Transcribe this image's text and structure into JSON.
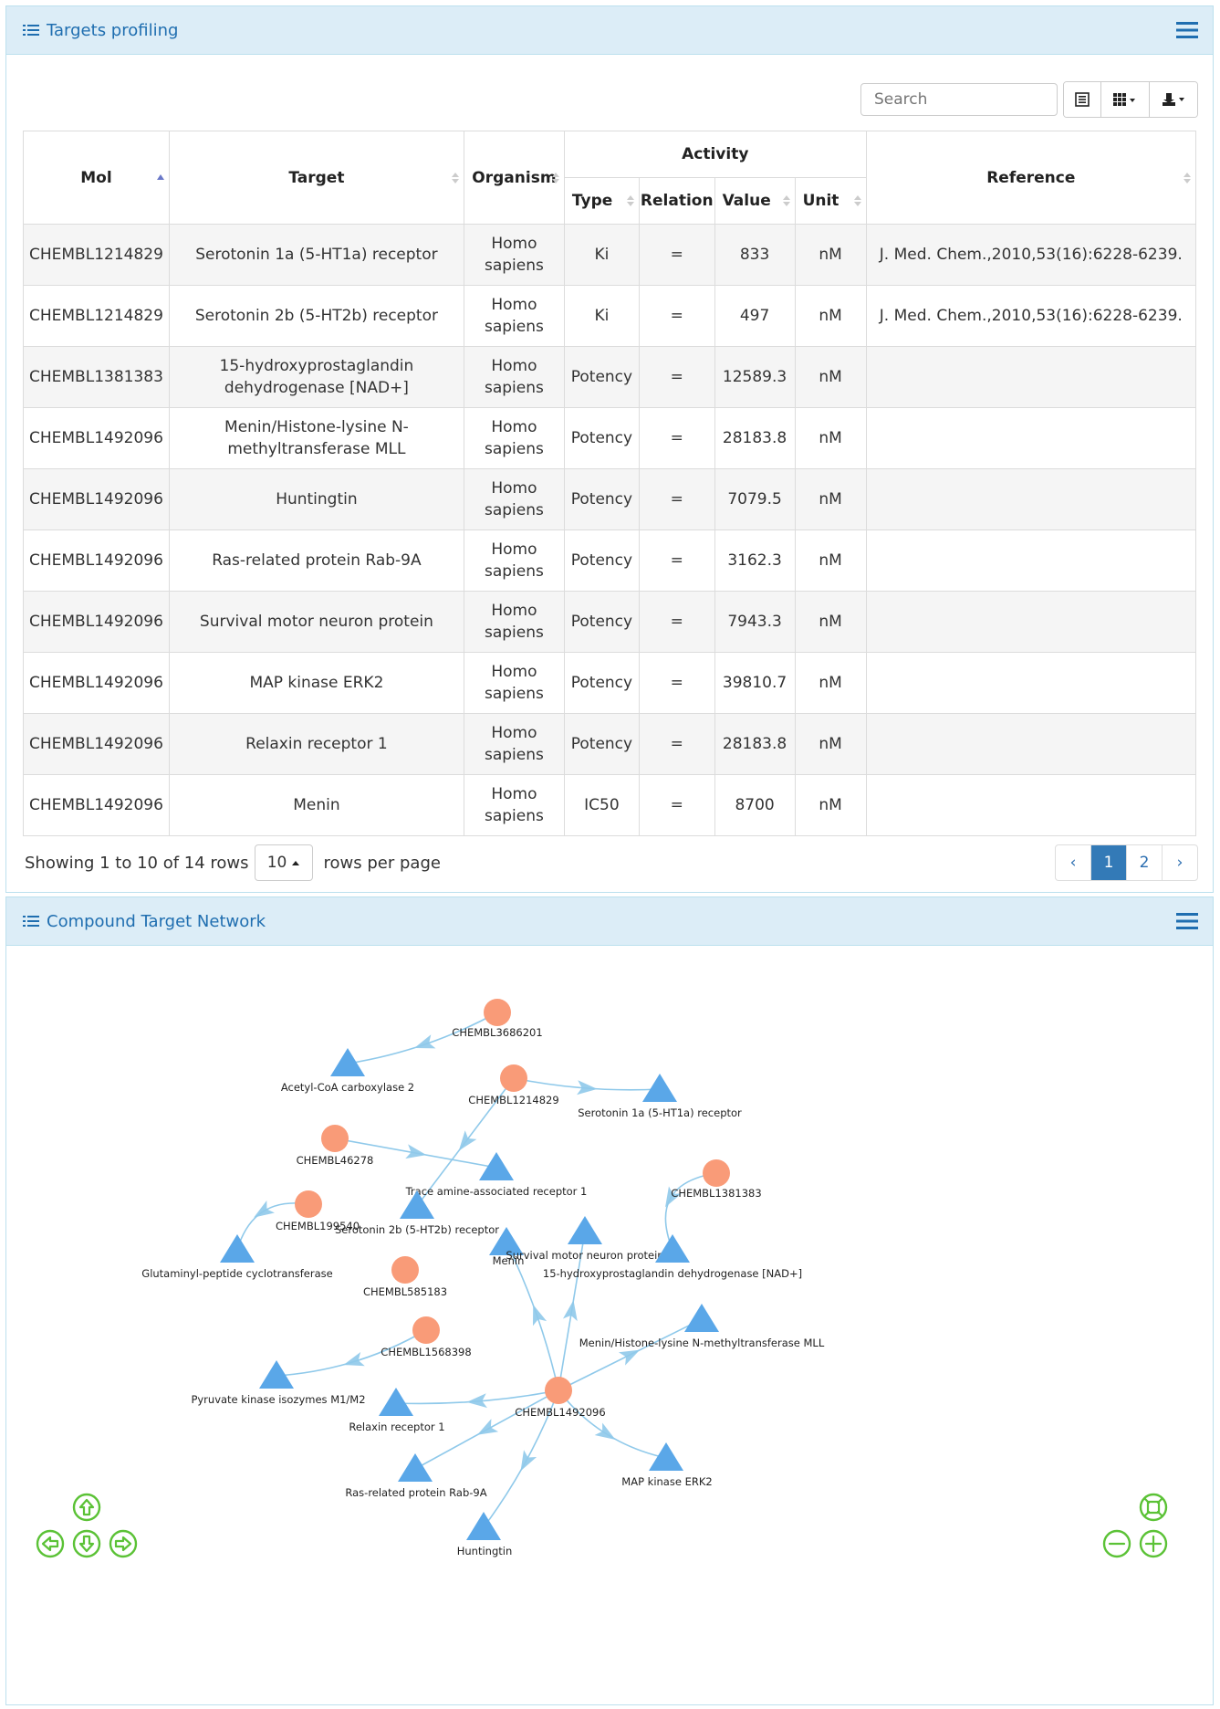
{
  "panels": {
    "targets_title": "Targets profiling",
    "network_title": "Compound Target Network"
  },
  "toolbar": {
    "search_placeholder": "Search"
  },
  "table": {
    "headers": {
      "mol": "Mol",
      "target": "Target",
      "organism": "Organism",
      "activity": "Activity",
      "type": "Type",
      "relation": "Relation",
      "value": "Value",
      "unit": "Unit",
      "reference": "Reference"
    },
    "rows": [
      {
        "mol": "CHEMBL1214829",
        "target": "Serotonin 1a (5-HT1a) receptor",
        "organism": "Homo sapiens",
        "type": "Ki",
        "relation": "=",
        "value": "833",
        "unit": "nM",
        "reference": "J. Med. Chem.,2010,53(16):6228-6239."
      },
      {
        "mol": "CHEMBL1214829",
        "target": "Serotonin 2b (5-HT2b) receptor",
        "organism": "Homo sapiens",
        "type": "Ki",
        "relation": "=",
        "value": "497",
        "unit": "nM",
        "reference": "J. Med. Chem.,2010,53(16):6228-6239."
      },
      {
        "mol": "CHEMBL1381383",
        "target": "15-hydroxyprostaglandin dehydrogenase [NAD+]",
        "organism": "Homo sapiens",
        "type": "Potency",
        "relation": "=",
        "value": "12589.3",
        "unit": "nM",
        "reference": ""
      },
      {
        "mol": "CHEMBL1492096",
        "target": "Menin/Histone-lysine N-methyltransferase MLL",
        "organism": "Homo sapiens",
        "type": "Potency",
        "relation": "=",
        "value": "28183.8",
        "unit": "nM",
        "reference": ""
      },
      {
        "mol": "CHEMBL1492096",
        "target": "Huntingtin",
        "organism": "Homo sapiens",
        "type": "Potency",
        "relation": "=",
        "value": "7079.5",
        "unit": "nM",
        "reference": ""
      },
      {
        "mol": "CHEMBL1492096",
        "target": "Ras-related protein Rab-9A",
        "organism": "Homo sapiens",
        "type": "Potency",
        "relation": "=",
        "value": "3162.3",
        "unit": "nM",
        "reference": ""
      },
      {
        "mol": "CHEMBL1492096",
        "target": "Survival motor neuron protein",
        "organism": "Homo sapiens",
        "type": "Potency",
        "relation": "=",
        "value": "7943.3",
        "unit": "nM",
        "reference": ""
      },
      {
        "mol": "CHEMBL1492096",
        "target": "MAP kinase ERK2",
        "organism": "Homo sapiens",
        "type": "Potency",
        "relation": "=",
        "value": "39810.7",
        "unit": "nM",
        "reference": ""
      },
      {
        "mol": "CHEMBL1492096",
        "target": "Relaxin receptor 1",
        "organism": "Homo sapiens",
        "type": "Potency",
        "relation": "=",
        "value": "28183.8",
        "unit": "nM",
        "reference": ""
      },
      {
        "mol": "CHEMBL1492096",
        "target": "Menin",
        "organism": "Homo sapiens",
        "type": "IC50",
        "relation": "=",
        "value": "8700",
        "unit": "nM",
        "reference": ""
      }
    ]
  },
  "footer": {
    "showing_text": "Showing 1 to 10 of 14 rows",
    "rows_per_page": "10",
    "rows_per_page_label": "rows per page",
    "pages": [
      "‹",
      "1",
      "2",
      "›"
    ],
    "active_page": "1"
  },
  "network": {
    "colors": {
      "compound": "#f99b78",
      "target": "#5aa7e8",
      "edge": "#8fc9ea",
      "controls": "#5bc236"
    },
    "compounds": [
      "CHEMBL3686201",
      "CHEMBL1214829",
      "CHEMBL46278",
      "CHEMBL1381383",
      "CHEMBL199540",
      "CHEMBL585183",
      "CHEMBL1568398",
      "CHEMBL1492096"
    ],
    "targets": [
      "Acetyl-CoA carboxylase 2",
      "Serotonin 1a (5-HT1a) receptor",
      "Trace amine-associated receptor 1",
      "Serotonin 2b (5-HT2b) receptor",
      "Glutaminyl-peptide cyclotransferase",
      "Menin",
      "Survival motor neuron protein",
      "15-hydroxyprostaglandin dehydrogenase [NAD+]",
      "Menin/Histone-lysine N-methyltransferase MLL",
      "Pyruvate kinase isozymes M1/M2",
      "Relaxin receptor 1",
      "MAP kinase ERK2",
      "Ras-related protein Rab-9A",
      "Huntingtin"
    ]
  }
}
